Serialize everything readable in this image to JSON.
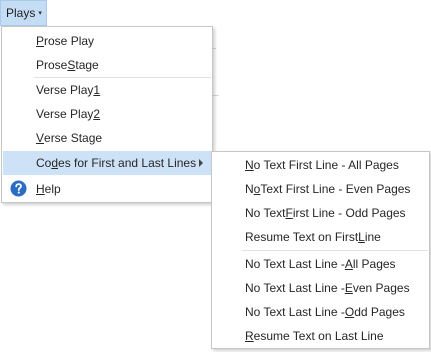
{
  "menubar": {
    "label": "Plays",
    "caret": "▾"
  },
  "main_menu": {
    "items": [
      {
        "pre": "",
        "key": "P",
        "post": "rose Play"
      },
      {
        "pre": "Prose ",
        "key": "S",
        "post": "tage"
      },
      {
        "pre": "Verse Play ",
        "key": "1",
        "post": ""
      },
      {
        "pre": "Verse Play ",
        "key": "2",
        "post": ""
      },
      {
        "pre": "",
        "key": "V",
        "post": "erse Stage"
      },
      {
        "pre": "Co",
        "key": "d",
        "post": "es for First and Last Lines"
      },
      {
        "pre": "",
        "key": "H",
        "post": "elp"
      }
    ]
  },
  "sub_menu": {
    "items": [
      {
        "pre": "",
        "key": "N",
        "post": "o Text First Line - All Pages"
      },
      {
        "pre": "N",
        "key": "o",
        "post": " Text First Line - Even Pages"
      },
      {
        "pre": "No Text ",
        "key": "F",
        "post": "irst Line - Odd Pages"
      },
      {
        "pre": "Resume Text on First ",
        "key": "L",
        "post": "ine"
      },
      {
        "pre": "No Text Last Line - ",
        "key": "A",
        "post": "ll Pages"
      },
      {
        "pre": "No Text Last Line - ",
        "key": "E",
        "post": "ven Pages"
      },
      {
        "pre": "No Text Last Line - ",
        "key": "O",
        "post": "dd Pages"
      },
      {
        "pre": "",
        "key": "R",
        "post": "esume Text on Last Line"
      }
    ]
  },
  "colors": {
    "highlight": "#cde2f7",
    "menubar_active": "#c5dcf5",
    "help_icon": "#2b6cc4"
  }
}
